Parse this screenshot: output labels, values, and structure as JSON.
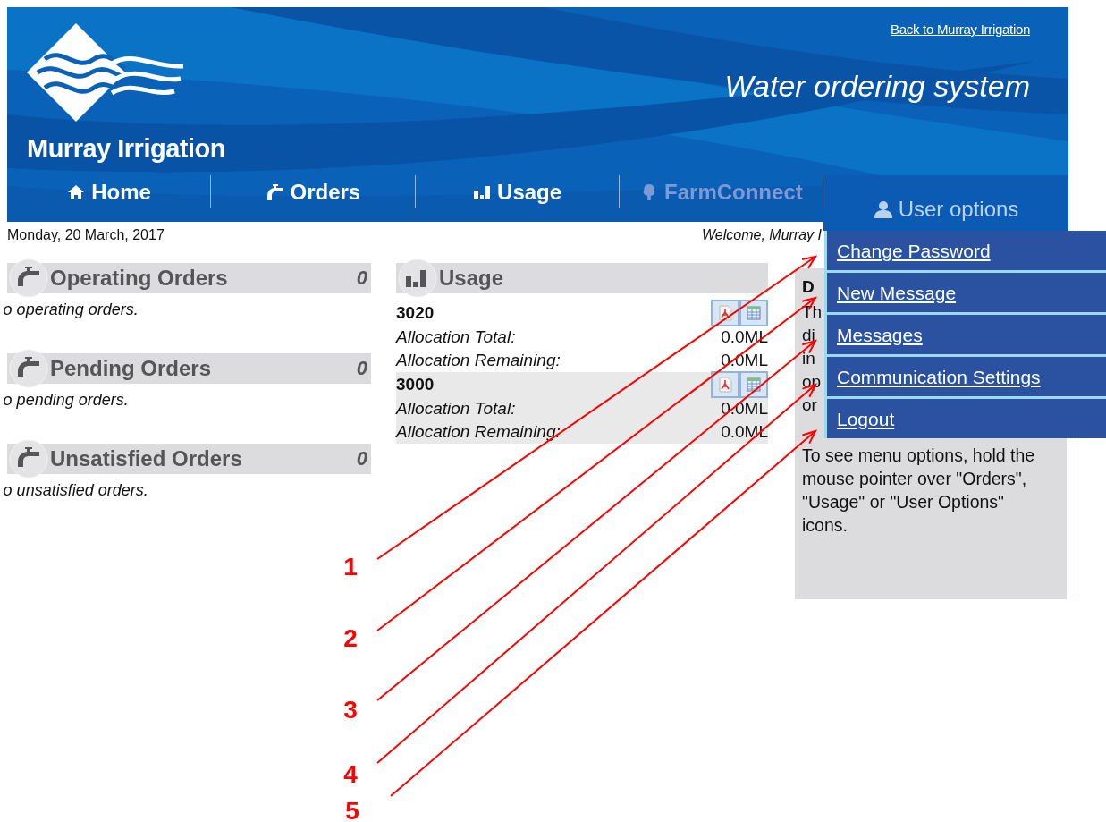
{
  "header": {
    "logo_text": "Murray Irrigation",
    "back_link": "Back to Murray Irrigation",
    "title": "Water ordering system"
  },
  "nav": [
    {
      "label": "Home",
      "disabled": false,
      "selected": false
    },
    {
      "label": "Orders",
      "disabled": false,
      "selected": false
    },
    {
      "label": "Usage",
      "disabled": false,
      "selected": false
    },
    {
      "label": "FarmConnect",
      "disabled": true,
      "selected": false
    },
    {
      "label": "User options",
      "disabled": false,
      "selected": true
    }
  ],
  "date": "Monday, 20 March, 2017",
  "welcome": "Welcome, Murray I",
  "order_sections": [
    {
      "title": "Operating Orders",
      "count": "0",
      "empty_text": " o operating orders."
    },
    {
      "title": "Pending Orders",
      "count": "0",
      "empty_text": " o pending orders."
    },
    {
      "title": "Unsatisfied Orders",
      "count": "0",
      "empty_text": " o unsatisfied orders."
    }
  ],
  "usage": {
    "title": "Usage",
    "accounts": [
      {
        "number": "3020",
        "rows": [
          {
            "label": "Allocation Total:",
            "value": "0.0ML"
          },
          {
            "label": "Allocation Remaining:",
            "value": "0.0ML"
          }
        ]
      },
      {
        "number": "3000",
        "rows": [
          {
            "label": "Allocation Total:",
            "value": "0.0ML"
          },
          {
            "label": "Allocation Remaining:",
            "value": "0.0ML"
          }
        ]
      }
    ]
  },
  "side_panel": {
    "heading": "D",
    "cut_lines": [
      "Th",
      "di",
      "in",
      "op",
      "or"
    ],
    "paragraph": "To see menu options, hold the mouse pointer over \"Orders\", \"Usage\" or \"User Options\" icons."
  },
  "user_menu": [
    "Change Password",
    "New Message",
    "Messages",
    "Communication Settings",
    "Logout"
  ],
  "annotations": [
    "1",
    "2",
    "3",
    "4",
    "5"
  ]
}
